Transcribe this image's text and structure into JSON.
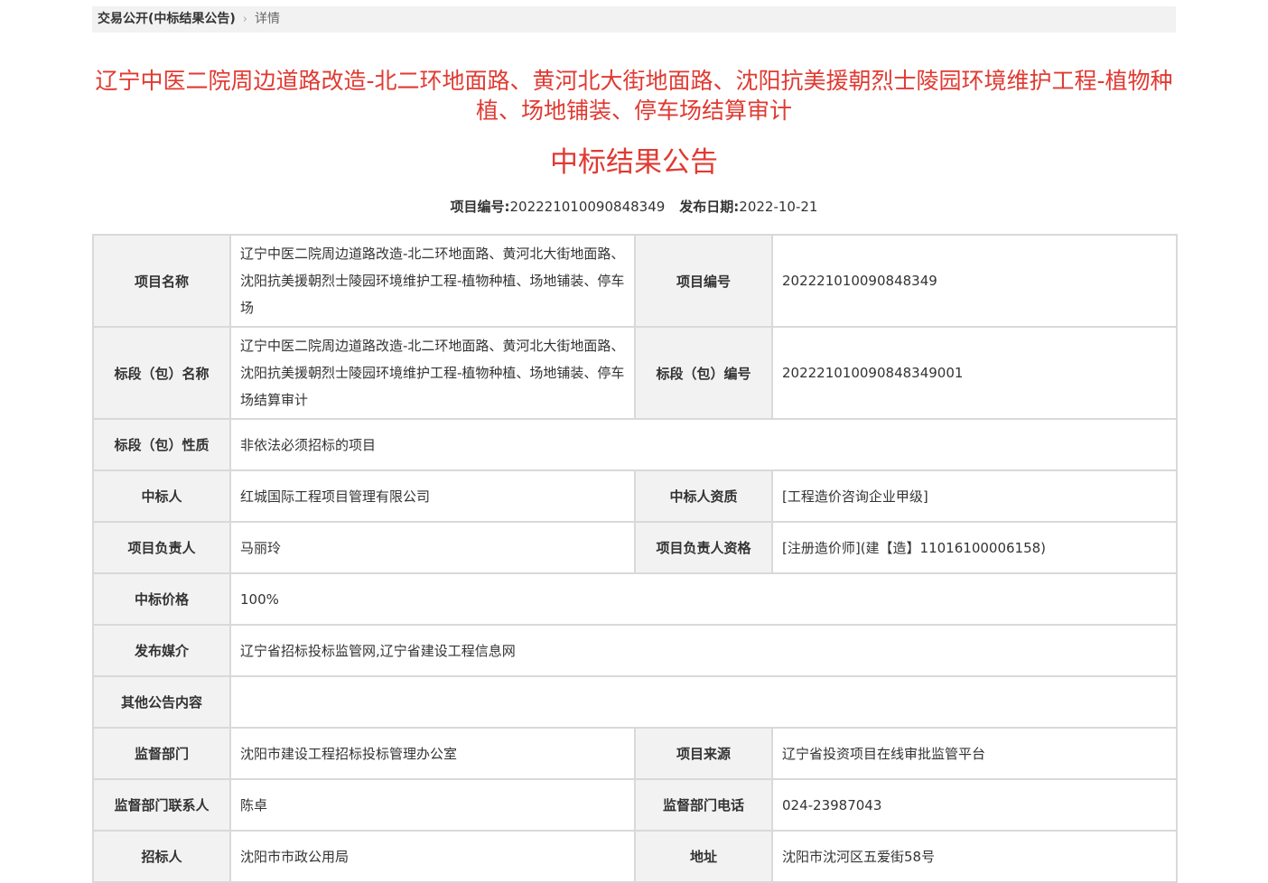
{
  "breadcrumb": {
    "link": "交易公开(中标结果公告)",
    "separator": "›",
    "current": "详情"
  },
  "title": "辽宁中医二院周边道路改造-北二环地面路、黄河北大街地面路、沈阳抗美援朝烈士陵园环境维护工程-植物种植、场地铺装、停车场结算审计",
  "subtitle": "中标结果公告",
  "meta": {
    "project_no_label": "项目编号:",
    "project_no": "202221010090848349",
    "publish_date_label": "发布日期:",
    "publish_date": "2022-10-21"
  },
  "table": {
    "rows": [
      {
        "l1": "项目名称",
        "v1": "辽宁中医二院周边道路改造-北二环地面路、黄河北大街地面路、沈阳抗美援朝烈士陵园环境维护工程-植物种植、场地铺装、停车场",
        "l2": "项目编号",
        "v2": "202221010090848349"
      },
      {
        "l1": "标段（包）名称",
        "v1": "辽宁中医二院周边道路改造-北二环地面路、黄河北大街地面路、沈阳抗美援朝烈士陵园环境维护工程-植物种植、场地铺装、停车场结算审计",
        "l2": "标段（包）编号",
        "v2": "202221010090848349001"
      },
      {
        "l1": "标段（包）性质",
        "v1": "非依法必须招标的项目"
      },
      {
        "l1": "中标人",
        "v1": "红城国际工程项目管理有限公司",
        "l2": "中标人资质",
        "v2": "[工程造价咨询企业甲级]"
      },
      {
        "l1": "项目负责人",
        "v1": "马丽玲",
        "l2": "项目负责人资格",
        "v2": "[注册造价师](建【造】11016100006158)"
      },
      {
        "l1": "中标价格",
        "v1": "100%"
      },
      {
        "l1": "发布媒介",
        "v1": "辽宁省招标投标监管网,辽宁省建设工程信息网"
      },
      {
        "l1": "其他公告内容",
        "v1": ""
      },
      {
        "l1": "监督部门",
        "v1": "沈阳市建设工程招标投标管理办公室",
        "l2": "项目来源",
        "v2": "辽宁省投资项目在线审批监管平台"
      },
      {
        "l1": "监督部门联系人",
        "v1": "陈卓",
        "l2": "监督部门电话",
        "v2": "024-23987043"
      },
      {
        "l1": "招标人",
        "v1": "沈阳市市政公用局",
        "l2": "地址",
        "v2": "沈阳市沈河区五爱街58号"
      }
    ]
  }
}
